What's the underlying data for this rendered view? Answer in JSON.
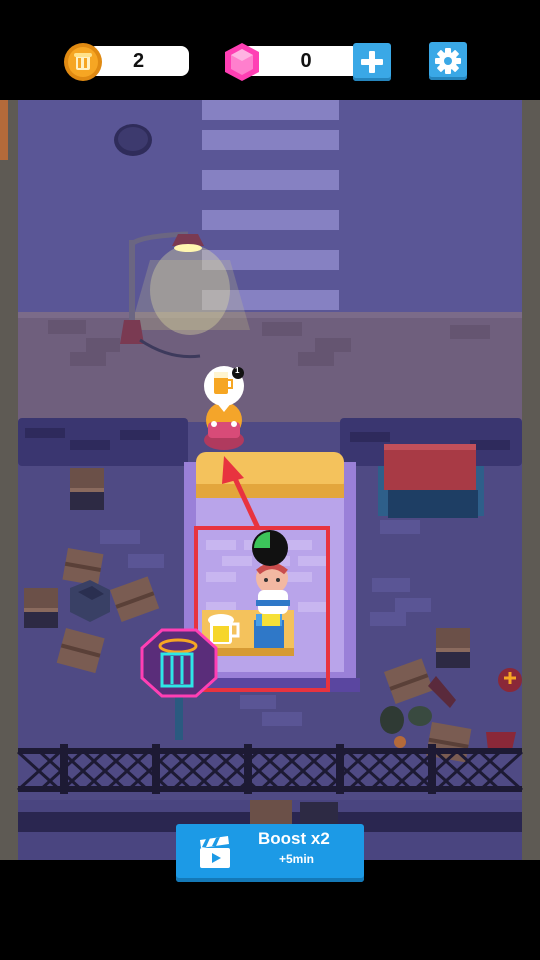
{
  "hud": {
    "coins": "2",
    "gems": "0",
    "coin_icon": "coin-icon",
    "gem_icon": "gem-icon",
    "add_icon": "plus-icon",
    "settings_icon": "gear-icon"
  },
  "scene": {
    "customer_order_count": "1",
    "order_item": "beer-mug-icon",
    "serving_timer_progress": 0.25
  },
  "boost": {
    "title": "Boost x2",
    "subtitle": "+5min",
    "icon": "video-clapper-icon"
  },
  "colors": {
    "accent_blue": "#3aa8e6",
    "gem_pink": "#ff3fb4",
    "coin_gold": "#f6a623",
    "highlight_red": "#e8333f"
  }
}
